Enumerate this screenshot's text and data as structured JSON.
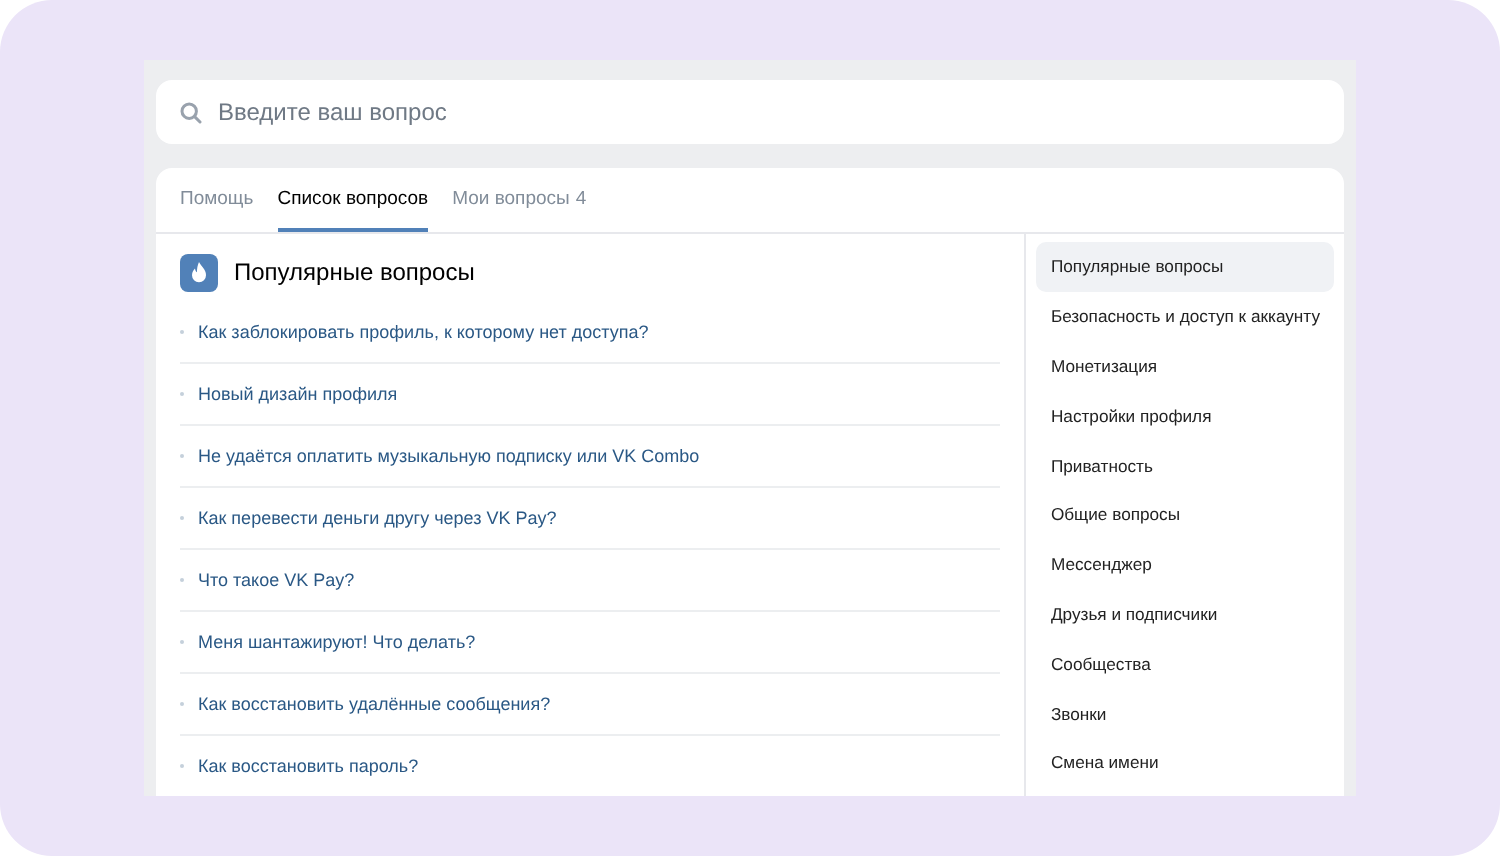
{
  "search": {
    "placeholder": "Введите ваш вопрос"
  },
  "tabs": [
    {
      "label": "Помощь",
      "selected": false
    },
    {
      "label": "Список вопросов",
      "selected": true
    },
    {
      "label": "Мои вопросы",
      "count": "4",
      "selected": false
    }
  ],
  "section": {
    "title": "Популярные вопросы"
  },
  "questions": [
    "Как заблокировать профиль, к которому нет доступа?",
    "Новый дизайн профиля",
    "Не удаётся оплатить музыкальную подписку или VK Combo",
    "Как перевести деньги другу через VK Pay?",
    "Что такое VK Pay?",
    "Меня шантажируют! Что делать?",
    "Как восстановить удалённые сообщения?",
    "Как восстановить пароль?"
  ],
  "categories": [
    {
      "label": "Популярные вопросы",
      "selected": true
    },
    {
      "label": "Безопасность и доступ к аккаунту",
      "selected": false
    },
    {
      "label": "Монетизация",
      "selected": false
    },
    {
      "label": "Настройки профиля",
      "selected": false
    },
    {
      "label": "Приватность",
      "selected": false
    },
    {
      "label": "Общие вопросы",
      "selected": false
    },
    {
      "label": "Мессенджер",
      "selected": false
    },
    {
      "label": "Друзья и подписчики",
      "selected": false
    },
    {
      "label": "Сообщества",
      "selected": false
    },
    {
      "label": "Звонки",
      "selected": false
    },
    {
      "label": "Смена имени",
      "selected": false
    }
  ]
}
